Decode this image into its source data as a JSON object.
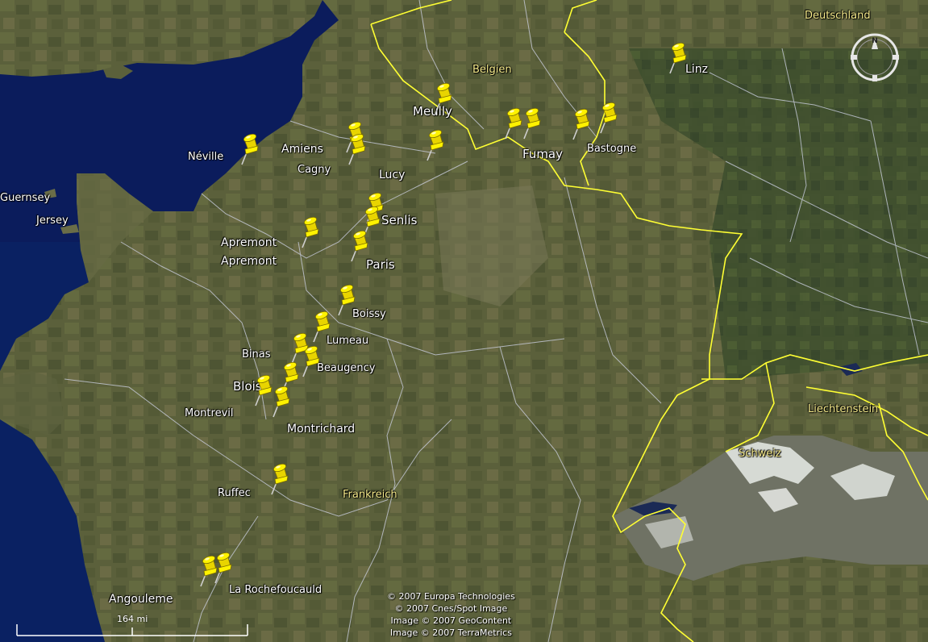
{
  "colors": {
    "sea": "#0a1a55",
    "land": "#5a5f3a",
    "country_border": "#ffff33",
    "region_border": "#cfd3e6",
    "pin_yellow": "#ffee00"
  },
  "countries": [
    {
      "id": "deutschland",
      "name": "Deutschland"
    },
    {
      "id": "belgien",
      "name": "Belgien"
    },
    {
      "id": "liechtenstein",
      "name": "Liechtenstein"
    },
    {
      "id": "schweiz",
      "name": "Schweiz"
    },
    {
      "id": "frankreich",
      "name": "Frankreich"
    }
  ],
  "places": [
    {
      "id": "guernsey",
      "name": "Guernsey"
    },
    {
      "id": "jersey",
      "name": "Jersey"
    },
    {
      "id": "neville",
      "name": "Néville"
    },
    {
      "id": "amiens",
      "name": "Amiens"
    },
    {
      "id": "cagny",
      "name": "Cagny"
    },
    {
      "id": "meully",
      "name": "Meully"
    },
    {
      "id": "lucy",
      "name": "Lucy"
    },
    {
      "id": "fumay",
      "name": "Fumay"
    },
    {
      "id": "bastogne",
      "name": "Bastogne"
    },
    {
      "id": "linz",
      "name": "Linz"
    },
    {
      "id": "senlis",
      "name": "Senlis"
    },
    {
      "id": "apremont1",
      "name": "Apremont"
    },
    {
      "id": "apremont2",
      "name": "Apremont"
    },
    {
      "id": "paris",
      "name": "Paris"
    },
    {
      "id": "boissy",
      "name": "Boissy"
    },
    {
      "id": "lumeau",
      "name": "Lumeau"
    },
    {
      "id": "binas",
      "name": "Binas"
    },
    {
      "id": "beaugency",
      "name": "Beaugency"
    },
    {
      "id": "blois",
      "name": "Blois"
    },
    {
      "id": "montrevil",
      "name": "Montrevil"
    },
    {
      "id": "montrichard",
      "name": "Montrichard"
    },
    {
      "id": "ruffec",
      "name": "Ruffec"
    },
    {
      "id": "angouleme",
      "name": "Angouleme"
    },
    {
      "id": "larochefoucauld",
      "name": "La Rochefoucauld"
    }
  ],
  "pin_count": 24,
  "compass": {
    "north_label": "N"
  },
  "scale": {
    "label": "164 mi"
  },
  "attribution": [
    "© 2007 Europa Technologies",
    "© 2007 Cnes/Spot Image",
    "Image © 2007 GeoContent",
    "Image © 2007 TerraMetrics"
  ]
}
